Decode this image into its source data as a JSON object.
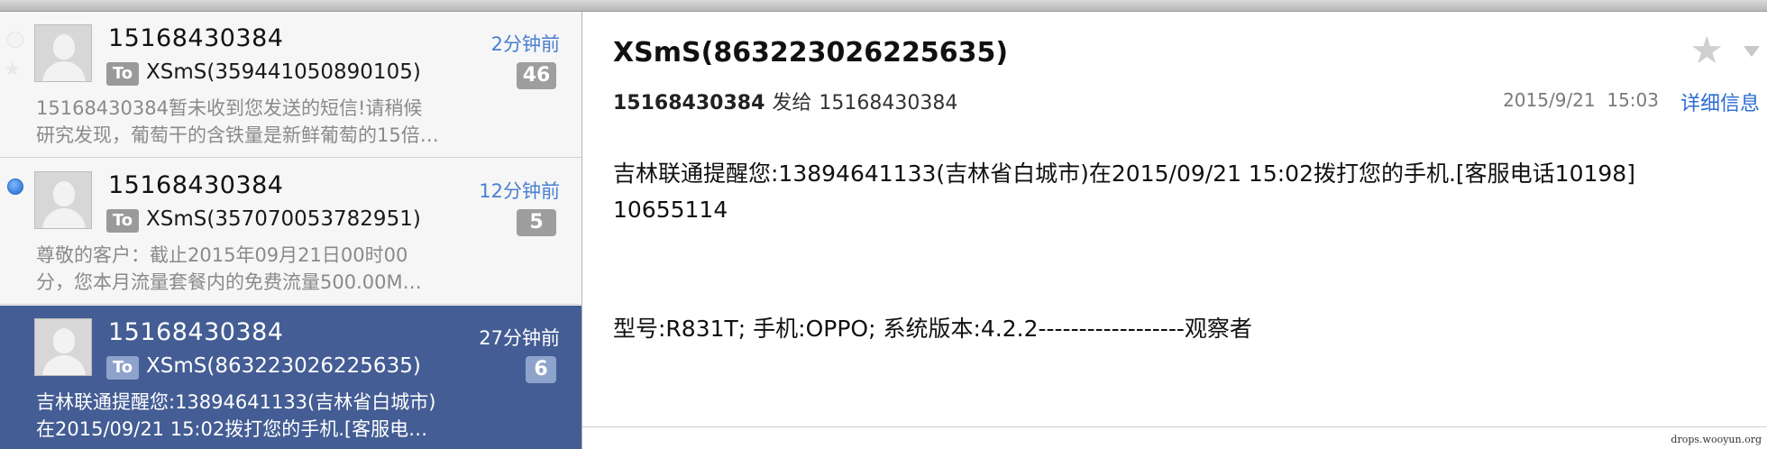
{
  "messages": [
    {
      "sender": "15168430384",
      "time": "2分钟前",
      "to_label": "To",
      "to_name": "XSmS(359441050890105)",
      "count": "46",
      "preview_line1": "15168430384暂未收到您发送的短信!请稍候",
      "preview_line2": "研究发现，葡萄干的含铁量是新鲜葡萄的15倍…"
    },
    {
      "sender": "15168430384",
      "time": "12分钟前",
      "to_label": "To",
      "to_name": "XSmS(357070053782951)",
      "count": "5",
      "preview_line1": "尊敬的客户：截止2015年09月21日00时00",
      "preview_line2": "分，您本月流量套餐内的免费流量500.00M…"
    },
    {
      "sender": "15168430384",
      "time": "27分钟前",
      "to_label": "To",
      "to_name": "XSmS(863223026225635)",
      "count": "6",
      "preview_line1": "吉林联通提醒您:13894641133(吉林省白城市)",
      "preview_line2": "在2015/09/21 15:02拨打您的手机.[客服电…"
    }
  ],
  "detail": {
    "subject": "XSmS(863223026225635)",
    "from": "15168430384",
    "sent_to_label": "发给",
    "to": "15168430384",
    "date": "2015/9/21",
    "time": "15:03",
    "details_link": "详细信息",
    "body_line1": "吉林联通提醒您:13894641133(吉林省白城市)在2015/09/21 15:02拨打您的手机.[客服电话10198]",
    "body_line2": "10655114",
    "signature": "型号:R831T; 手机:OPPO; 系统版本:4.2.2------------------观察者"
  },
  "watermark": "drops.wooyun.org",
  "icons": {
    "star": "star-icon",
    "caret": "chevron-down-icon",
    "unread": "unread-dot-icon",
    "avatar": "person-icon"
  },
  "colors": {
    "selected_bg": "#445d94",
    "link": "#2b6cd2",
    "unread_dot": "#3a7fdc"
  }
}
